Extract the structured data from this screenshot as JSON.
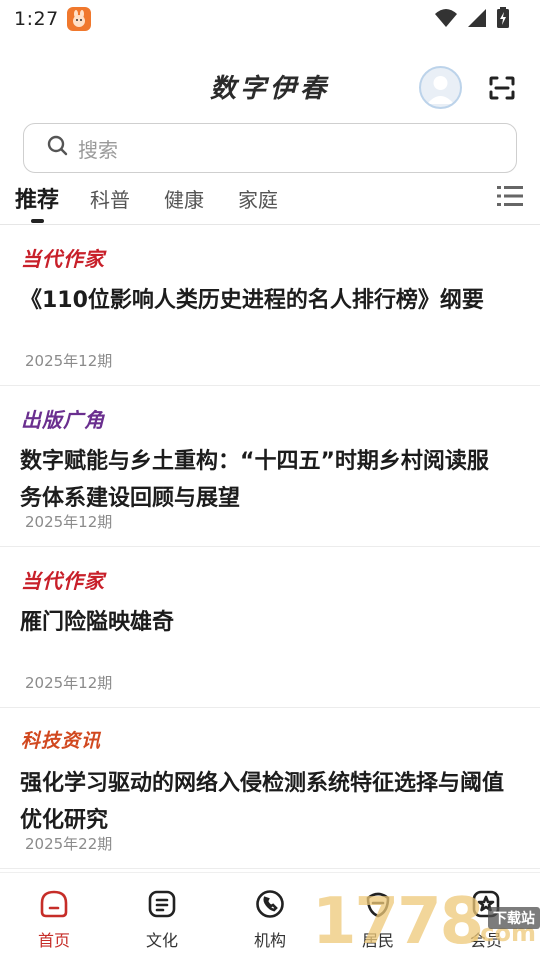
{
  "status_bar": {
    "time": "1:27",
    "app_icon": "bunny-app-icon",
    "wifi_icon": "wifi-icon",
    "signal_icon": "cell-signal-icon",
    "battery_icon": "battery-charging-icon"
  },
  "header": {
    "title": "数字伊春",
    "avatar_icon": "user-avatar-icon",
    "scan_icon": "scan-icon"
  },
  "search": {
    "placeholder": "搜索",
    "icon": "search-icon"
  },
  "tabs": [
    {
      "label": "推荐",
      "active": true
    },
    {
      "label": "科普",
      "active": false
    },
    {
      "label": "健康",
      "active": false
    },
    {
      "label": "家庭",
      "active": false
    }
  ],
  "tab_menu_icon": "list-menu-icon",
  "articles": [
    {
      "source": "当代作家",
      "source_color": "#c8202a",
      "title": "《110位影响人类历史进程的名人排行榜》纲要",
      "issue": "2025年12期"
    },
    {
      "source": "出版广角",
      "source_color": "#6a2f8f",
      "title": "数字赋能与乡土重构：“十四五”时期乡村阅读服务体系建设回顾与展望",
      "issue": "2025年12期"
    },
    {
      "source": "当代作家",
      "source_color": "#c8202a",
      "title": "雁门险隘映雄奇",
      "issue": "2025年12期"
    },
    {
      "source": "科技资讯",
      "source_color": "#d1481f",
      "title": "强化学习驱动的网络入侵检测系统特征选择与阈值优化研究",
      "issue": "2025年22期"
    }
  ],
  "bottom_nav": [
    {
      "label": "首页",
      "icon": "home-icon",
      "active": true
    },
    {
      "label": "文化",
      "icon": "document-icon",
      "active": false
    },
    {
      "label": "机构",
      "icon": "phone-icon",
      "active": false
    },
    {
      "label": "居民",
      "icon": "resident-icon",
      "active": false
    },
    {
      "label": "会员",
      "icon": "member-icon",
      "active": false
    }
  ],
  "watermark": {
    "digits": "1778",
    "suffix": ".com",
    "tag": "下载站"
  },
  "colors": {
    "accent": "#c62d28",
    "text": "#1c1c1c",
    "meta": "#8b8b8b"
  }
}
